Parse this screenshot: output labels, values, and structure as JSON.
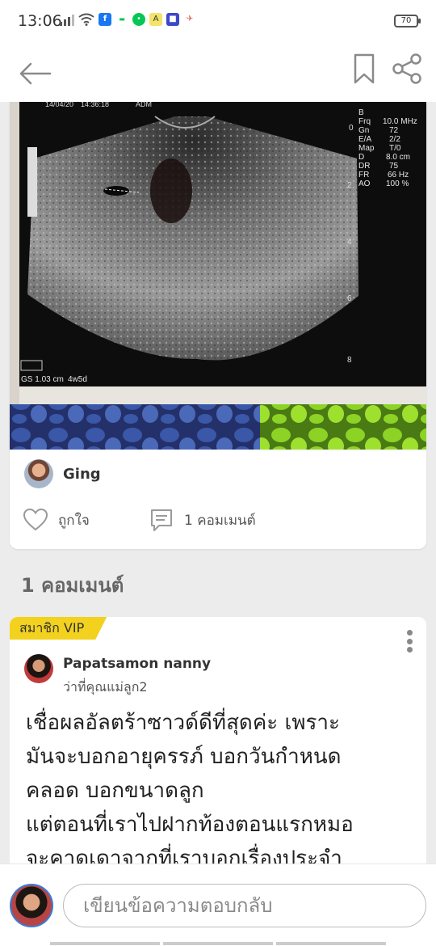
{
  "status_bar": {
    "time": "13:06",
    "battery": "70",
    "icons": [
      "signal-icon",
      "wifi-icon",
      "facebook-icon",
      "line-icon",
      "line-green-icon",
      "app-a-icon",
      "app-game-icon",
      "app-misc-icon"
    ],
    "colors": {
      "facebook": "#1877f2",
      "line": "#06c755"
    }
  },
  "header": {
    "back_icon": "back-arrow-icon",
    "bookmark_icon": "bookmark-icon",
    "share_icon": "share-icon"
  },
  "post": {
    "photo_overlay": {
      "date": "14/04/20",
      "time": "14:36:18",
      "code": "ADM",
      "params": [
        "B",
        "Frq",
        "10.0 MHz",
        "Gn",
        "72",
        "E/A",
        "2/2",
        "Map",
        "T/0",
        "D",
        "8.0 cm",
        "DR",
        "75",
        "FR",
        "66 Hz",
        "AO",
        "100 %"
      ],
      "depth_marks": [
        "0",
        "2",
        "4",
        "6",
        "8"
      ],
      "measurement": "GS 1.03 cm",
      "gestation": "4w5d"
    },
    "author": {
      "name": "Ging",
      "avatar_icon": "avatar"
    },
    "like_label": "ถูกใจ",
    "like_icon": "heart-icon",
    "comment_label": "1 คอมเมนต์",
    "comment_icon": "comment-icon"
  },
  "comments": {
    "heading": "1 คอมเมนต์",
    "items": [
      {
        "badge": "สมาชิก VIP",
        "name": "Papatsamon nanny",
        "role": "ว่าที่คุณแม่ลูก2",
        "text": "เชื่อผลอัลตร้าซาวด์ดีที่สุดค่ะ เพราะ\nมันจะบอกอายุครรภ์ บอกวันกำหนด\nคลอด บอกขนาดลูก\nแต่ตอนที่เราไปฝากท้องตอนแรกหมอ\nจะคาดเดาจากที่เราบอกเรื่องประจำ",
        "more_icon": "more-vertical-icon"
      }
    ]
  },
  "reply": {
    "placeholder": "เขียนข้อความตอบกลับ"
  },
  "colors": {
    "vip_badge": "#f2d21e",
    "background": "#ececec",
    "icon_gray": "#9a9a9a"
  }
}
